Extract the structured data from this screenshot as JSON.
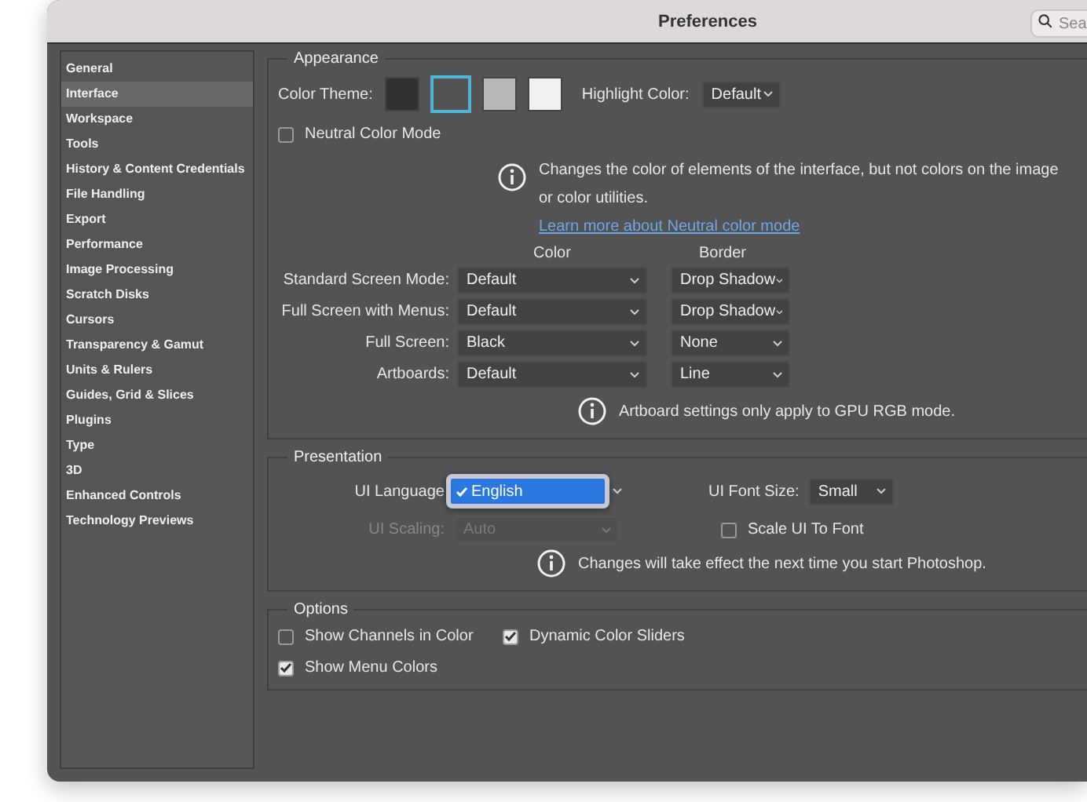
{
  "window": {
    "title": "Preferences",
    "search": {
      "placeholder": "Sea"
    }
  },
  "sidebar": {
    "items": [
      {
        "label": "General",
        "selected": false
      },
      {
        "label": "Interface",
        "selected": true
      },
      {
        "label": "Workspace",
        "selected": false
      },
      {
        "label": "Tools",
        "selected": false
      },
      {
        "label": "History & Content Credentials",
        "selected": false
      },
      {
        "label": "File Handling",
        "selected": false
      },
      {
        "label": "Export",
        "selected": false
      },
      {
        "label": "Performance",
        "selected": false
      },
      {
        "label": "Image Processing",
        "selected": false
      },
      {
        "label": "Scratch Disks",
        "selected": false
      },
      {
        "label": "Cursors",
        "selected": false
      },
      {
        "label": "Transparency & Gamut",
        "selected": false
      },
      {
        "label": "Units & Rulers",
        "selected": false
      },
      {
        "label": "Guides, Grid & Slices",
        "selected": false
      },
      {
        "label": "Plugins",
        "selected": false
      },
      {
        "label": "Type",
        "selected": false
      },
      {
        "label": "3D",
        "selected": false
      },
      {
        "label": "Enhanced Controls",
        "selected": false
      },
      {
        "label": "Technology Previews",
        "selected": false
      }
    ]
  },
  "appearance": {
    "title": "Appearance",
    "color_theme_label": "Color Theme:",
    "themes": [
      {
        "color": "#323232",
        "selected": false
      },
      {
        "color": "#535353",
        "selected": true
      },
      {
        "color": "#b8b8b8",
        "selected": false
      },
      {
        "color": "#f0f0f0",
        "selected": false
      }
    ],
    "highlight_label": "Highlight Color:",
    "highlight_value": "Default",
    "neutral_mode": {
      "label": "Neutral Color Mode",
      "checked": false
    },
    "neutral_info": "Changes the color of elements of the interface, but not colors on the image or color utilities.",
    "neutral_link": "Learn more about Neutral color mode",
    "columns": [
      "Color",
      "Border"
    ],
    "rows": [
      {
        "label": "Standard Screen Mode:",
        "color_mode": "Default",
        "border": "Drop Shadow"
      },
      {
        "label": "Full Screen with Menus:",
        "color_mode": "Default",
        "border": "Drop Shadow"
      },
      {
        "label": "Full Screen:",
        "color_mode": "Black",
        "border": "None"
      },
      {
        "label": "Artboards:",
        "color_mode": "Default",
        "border": "Line"
      }
    ],
    "artboard_info": "Artboard settings only apply to GPU RGB mode."
  },
  "presentation": {
    "title": "Presentation",
    "ui_language": {
      "label": "UI Language",
      "open": true,
      "options": [
        {
          "label": "English",
          "checked": true
        }
      ]
    },
    "ui_font_size": {
      "label": "UI Font Size:",
      "value": "Small"
    },
    "ui_scaling": {
      "label": "UI Scaling:",
      "value": "Auto",
      "disabled": true
    },
    "scale_to_font": {
      "label": "Scale UI To Font",
      "checked": false
    },
    "info": "Changes will take effect the next time you start Photoshop."
  },
  "options": {
    "title": "Options",
    "items": [
      {
        "label": "Show Channels in Color",
        "checked": false
      },
      {
        "label": "Dynamic Color Sliders",
        "checked": true
      },
      {
        "label": "Show Menu Colors",
        "checked": true
      }
    ]
  }
}
